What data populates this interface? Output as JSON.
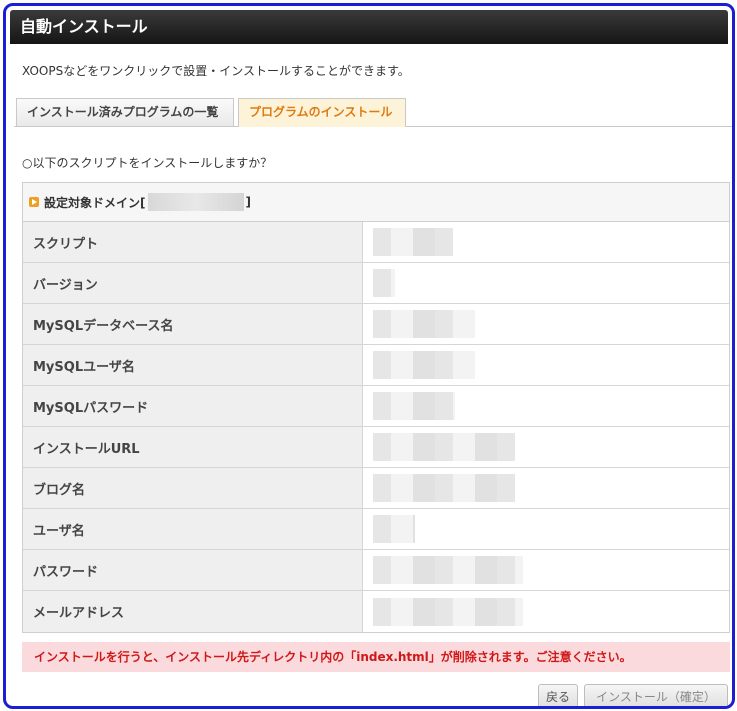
{
  "window": {
    "title": "自動インストール"
  },
  "intro_text": "XOOPSなどをワンクリックで設置・インストールすることができます。",
  "tabs": [
    {
      "label": "インストール済みプログラムの一覧",
      "active": false
    },
    {
      "label": "プログラムのインストール",
      "active": true
    }
  ],
  "question_text": "○以下のスクリプトをインストールしますか？",
  "domain_header": {
    "label_prefix": "設定対象ドメイン[",
    "label_suffix": "]"
  },
  "fields": [
    {
      "label": "スクリプト"
    },
    {
      "label": "バージョン"
    },
    {
      "label": "MySQLデータベース名"
    },
    {
      "label": "MySQLユーザ名"
    },
    {
      "label": "MySQLパスワード"
    },
    {
      "label": "インストールURL"
    },
    {
      "label": "ブログ名"
    },
    {
      "label": "ユーザ名"
    },
    {
      "label": "パスワード"
    },
    {
      "label": "メールアドレス"
    }
  ],
  "warning_text": "インストールを行うと、インストール先ディレクトリ内の「index.html」が削除されます。ご注意ください。",
  "buttons": {
    "back": "戻る",
    "install": "インストール（確定）"
  },
  "colors": {
    "frame_border": "#1a1fd0",
    "active_tab_text": "#e07a10",
    "warning_text": "#d01818",
    "warning_bg": "#fadadc"
  }
}
